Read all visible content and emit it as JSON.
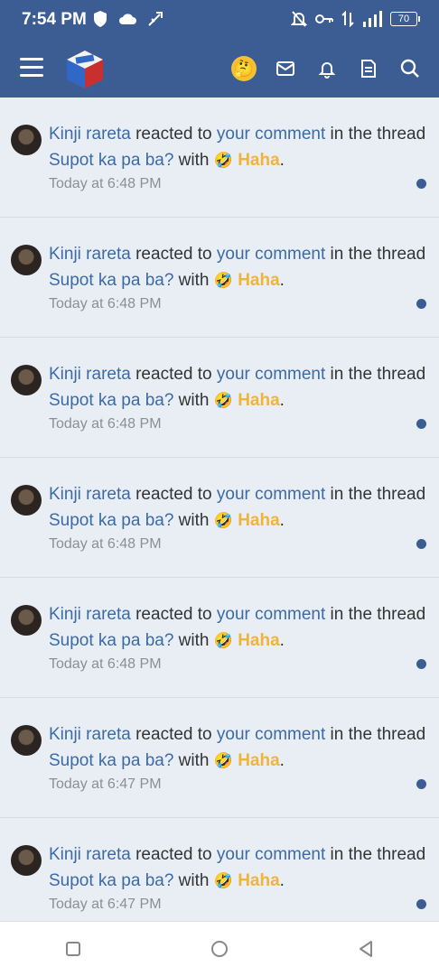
{
  "status_bar": {
    "time": "7:54 PM",
    "battery": "70",
    "left_icons": [
      "shield-icon",
      "cloud-icon",
      "usb-icon"
    ],
    "right_icons": [
      "bell-off-icon",
      "key-icon",
      "data-transfer-icon",
      "signal-icon",
      "battery-icon"
    ]
  },
  "app_bar": {
    "icons": [
      "menu-icon",
      "site-logo",
      "profile-avatar",
      "mail-icon",
      "bell-icon",
      "document-icon",
      "search-icon"
    ]
  },
  "notifications": [
    {
      "user": "Kinji rareta",
      "action": " reacted to ",
      "target": "your comment",
      "mid": " in the thread ",
      "thread": "Supot ka pa ba?",
      "with": " with ",
      "emoji": "🤣",
      "reaction": "Haha",
      "end": ".",
      "time": "Today at 6:48 PM"
    },
    {
      "user": "Kinji rareta",
      "action": " reacted to ",
      "target": "your comment",
      "mid": " in the thread ",
      "thread": "Supot ka pa ba?",
      "with": " with ",
      "emoji": "🤣",
      "reaction": "Haha",
      "end": ".",
      "time": "Today at 6:48 PM"
    },
    {
      "user": "Kinji rareta",
      "action": " reacted to ",
      "target": "your comment",
      "mid": " in the thread ",
      "thread": "Supot ka pa ba?",
      "with": " with ",
      "emoji": "🤣",
      "reaction": "Haha",
      "end": ".",
      "time": "Today at 6:48 PM"
    },
    {
      "user": "Kinji rareta",
      "action": " reacted to ",
      "target": "your comment",
      "mid": " in the thread ",
      "thread": "Supot ka pa ba?",
      "with": " with ",
      "emoji": "🤣",
      "reaction": "Haha",
      "end": ".",
      "time": "Today at 6:48 PM"
    },
    {
      "user": "Kinji rareta",
      "action": " reacted to ",
      "target": "your comment",
      "mid": " in the thread ",
      "thread": "Supot ka pa ba?",
      "with": " with ",
      "emoji": "🤣",
      "reaction": "Haha",
      "end": ".",
      "time": "Today at 6:48 PM"
    },
    {
      "user": "Kinji rareta",
      "action": " reacted to ",
      "target": "your comment",
      "mid": " in the thread ",
      "thread": "Supot ka pa ba?",
      "with": " with ",
      "emoji": "🤣",
      "reaction": "Haha",
      "end": ".",
      "time": "Today at 6:47 PM"
    },
    {
      "user": "Kinji rareta",
      "action": " reacted to ",
      "target": "your comment",
      "mid": " in the thread ",
      "thread": "Supot ka pa ba?",
      "with": " with ",
      "emoji": "🤣",
      "reaction": "Haha",
      "end": ".",
      "time": "Today at 6:47 PM"
    }
  ],
  "nav_bar": {
    "buttons": [
      "recent-apps-icon",
      "home-icon",
      "back-icon"
    ]
  },
  "colors": {
    "primary": "#3b5d93",
    "link": "#3b6aa6",
    "reaction": "#f0b43a",
    "background": "#e9eef5"
  }
}
